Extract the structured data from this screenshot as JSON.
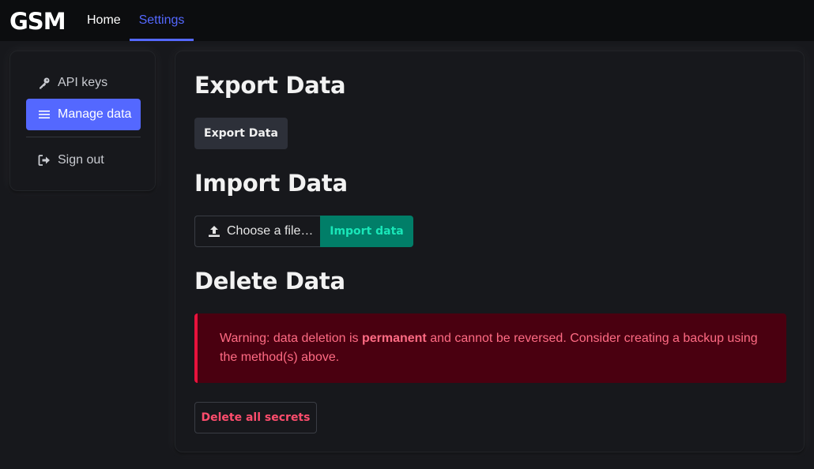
{
  "navbar": {
    "brand": "GSM",
    "home_label": "Home",
    "settings_label": "Settings"
  },
  "sidebar": {
    "items": [
      {
        "label": "API keys",
        "icon": "key-icon"
      },
      {
        "label": "Manage data",
        "icon": "list-icon",
        "active": true
      },
      {
        "label": "Sign out",
        "icon": "sign-out-icon"
      }
    ]
  },
  "export": {
    "heading": "Export Data",
    "button_label": "Export Data"
  },
  "import": {
    "heading": "Import Data",
    "choose_label": "Choose a file…",
    "button_label": "Import data"
  },
  "delete": {
    "heading": "Delete Data",
    "warning_prefix": "Warning: data deletion is ",
    "warning_bold": "permanent",
    "warning_suffix": " and cannot be reversed. Consider creating a backup using the method(s) above.",
    "button_label": "Delete all secrets"
  },
  "colors": {
    "accent": "#5468ff",
    "import_bg": "#017e68",
    "danger": "#e8123c",
    "warning_bg": "#4a0010"
  }
}
